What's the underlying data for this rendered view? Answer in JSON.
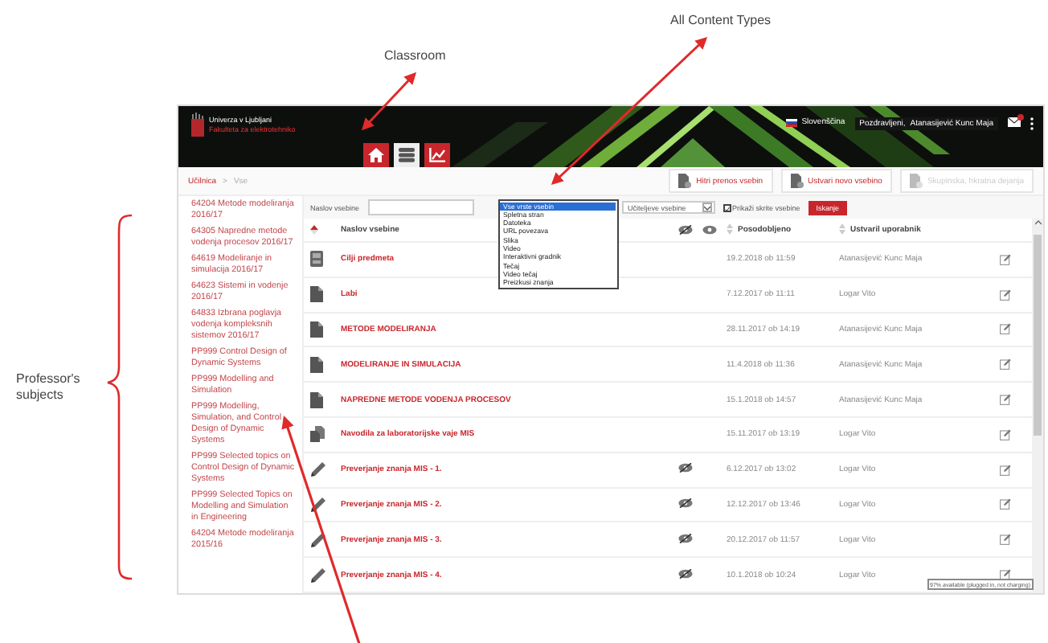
{
  "header": {
    "logo_lines": [
      "Univerza v Ljubljani",
      "Fakulteta za elektrotehniko"
    ],
    "language": "Slovenščina",
    "greeting": "Pozdravljeni,",
    "user": "Atanasijević Kunc Maja",
    "nav": [
      {
        "kind": "home",
        "selected": false
      },
      {
        "kind": "classroom",
        "selected": true
      },
      {
        "kind": "chart",
        "selected": false
      }
    ]
  },
  "breadcrumb": {
    "items": [
      "Učilnica",
      "Vse"
    ],
    "separator": ">"
  },
  "actions": [
    {
      "label": "Hitri prenos vsebin",
      "disabled": false
    },
    {
      "label": "Ustvari novo vsebino",
      "disabled": false
    },
    {
      "label": "Skupinska, hkratna dejanja",
      "disabled": true
    }
  ],
  "sidebar": {
    "items": [
      {
        "label": "64204 Metode modeliranja 2016/17"
      },
      {
        "label": "64305 Napredne metode vodenja procesov 2016/17"
      },
      {
        "label": "64619 Modeliranje in simulacija 2016/17"
      },
      {
        "label": "64623 Sistemi in vodenje 2016/17"
      },
      {
        "label": "64833 Izbrana poglavja vodenja kompleksnih sistemov 2016/17"
      },
      {
        "label": "PP999 Control Design of Dynamic Systems"
      },
      {
        "label": "PP999 Modelling and Simulation"
      },
      {
        "label": "PP999 Modelling, Simulation, and Control Design of Dynamic Systems"
      },
      {
        "label": "PP999 Selected topics on Control Design of Dynamic Systems"
      },
      {
        "label": "PP999 Selected Topics on Modelling and Simulation in Engineering"
      },
      {
        "label": "64204 Metode modeliranja 2015/16"
      }
    ]
  },
  "filters": {
    "title_label": "Naslov vsebine",
    "type_options": [
      {
        "label": "Vse vrste vsebin",
        "selected": true
      },
      {
        "label": "Spletna stran",
        "selected": false
      },
      {
        "label": "Datoteka",
        "selected": false
      },
      {
        "label": "URL povezava",
        "selected": false
      },
      {
        "label": "Slika",
        "selected": false
      },
      {
        "label": "Video",
        "selected": false
      },
      {
        "label": "Interaktivni gradnik",
        "selected": false
      },
      {
        "label": "Tečaj",
        "selected": false
      },
      {
        "label": "Video tečaj",
        "selected": false
      },
      {
        "label": "Preizkusi znanja",
        "selected": false
      }
    ],
    "owner_select": "Učiteljeve vsebine",
    "show_hidden": {
      "label": "Prikaži skrite vsebine",
      "checked": true
    },
    "search_button": "Iskanje"
  },
  "table": {
    "columns": [
      "Naslov vsebine",
      "Posodobljeno",
      "Ustvaril uporabnik"
    ],
    "rows": [
      {
        "kind": "slides",
        "title": "Cilji predmeta",
        "hidden": false,
        "updated": "19.2.2018 ob 11:59",
        "author": "Atanasijević Kunc Maja"
      },
      {
        "kind": "document",
        "title": "Labi",
        "hidden": false,
        "updated": "7.12.2017 ob 11:11",
        "author": "Logar Vito"
      },
      {
        "kind": "document",
        "title": "METODE MODELIRANJA",
        "hidden": false,
        "updated": "28.11.2017 ob 14:19",
        "author": "Atanasijević Kunc Maja"
      },
      {
        "kind": "document",
        "title": "MODELIRANJE IN SIMULACIJA",
        "hidden": false,
        "updated": "11.4.2018 ob 11:36",
        "author": "Atanasijević Kunc Maja"
      },
      {
        "kind": "document",
        "title": "NAPREDNE METODE VODENJA PROCESOV",
        "hidden": false,
        "updated": "15.1.2018 ob 14:57",
        "author": "Atanasijević Kunc Maja"
      },
      {
        "kind": "copy",
        "title": "Navodila za laboratorijske vaje MIS",
        "hidden": false,
        "updated": "15.11.2017 ob 13:19",
        "author": "Logar Vito"
      },
      {
        "kind": "quiz",
        "title": "Preverjanje znanja MIS - 1.",
        "hidden": true,
        "updated": "6.12.2017 ob 13:02",
        "author": "Logar Vito"
      },
      {
        "kind": "quiz",
        "title": "Preverjanje znanja MIS - 2.",
        "hidden": true,
        "updated": "12.12.2017 ob 13:46",
        "author": "Logar Vito"
      },
      {
        "kind": "quiz",
        "title": "Preverjanje znanja MIS - 3.",
        "hidden": true,
        "updated": "20.12.2017 ob 11:57",
        "author": "Logar Vito"
      },
      {
        "kind": "quiz",
        "title": "Preverjanje znanja MIS - 4.",
        "hidden": true,
        "updated": "10.1.2018 ob 10:24",
        "author": "Logar Vito"
      }
    ]
  },
  "battery_tooltip": "97% available (plugged in, not charging)",
  "annotations": [
    {
      "text": "All Content Types"
    },
    {
      "text": "Classroom"
    },
    {
      "text": "Professor's subjects"
    }
  ]
}
